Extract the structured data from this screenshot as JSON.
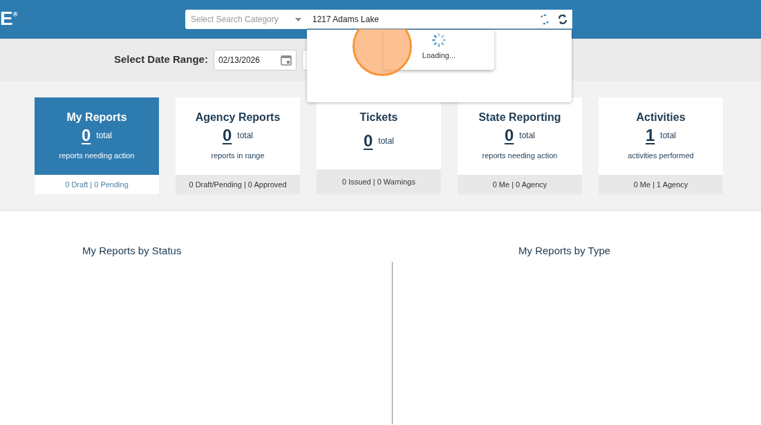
{
  "header": {
    "logo": "E",
    "logo_mark": "®",
    "search_category": {
      "placeholder": "Select Search Category"
    },
    "search": {
      "value": "1217 Adams Lake"
    }
  },
  "search_dropdown": {
    "loading_text": "Loading..."
  },
  "date_range": {
    "label": "Select Date Range:",
    "start": "02/13/2026"
  },
  "cards": [
    {
      "title": "My Reports",
      "count": "0",
      "unit": "total",
      "subtitle": "reports needing action",
      "footer": "0 Draft | 0 Pending",
      "selected": true
    },
    {
      "title": "Agency Reports",
      "count": "0",
      "unit": "total",
      "subtitle": "reports in range",
      "footer": "0 Draft/Pending | 0 Approved",
      "selected": false
    },
    {
      "title": "Tickets",
      "count": "0",
      "unit": "total",
      "footer": "0 Issued | 0 Warnings",
      "selected": false
    },
    {
      "title": "State Reporting",
      "count": "0",
      "unit": "total",
      "subtitle": "reports needing action",
      "footer": "0 Me | 0 Agency",
      "selected": false
    },
    {
      "title": "Activities",
      "count": "1",
      "unit": "total",
      "subtitle": "activities performed",
      "footer": "0 Me | 1 Agency",
      "selected": false
    }
  ],
  "charts": [
    {
      "title": "My Reports by Status"
    },
    {
      "title": "My Reports by Type"
    }
  ]
}
